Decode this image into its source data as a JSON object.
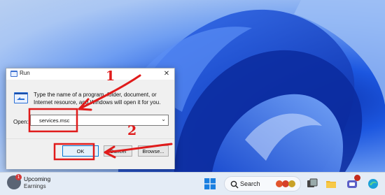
{
  "dialog": {
    "title": "Run",
    "description": "Type the name of a program, folder, document, or Internet resource, and Windows will open it for you.",
    "open_label": "Open:",
    "open_value": "services.msc",
    "ok_label": "OK",
    "cancel_label": "Cancel",
    "browse_label": "Browse...",
    "close_glyph": "✕",
    "dropdown_glyph": "⌄"
  },
  "annotations": {
    "step1": "1",
    "step2": "2",
    "color": "#e01b1b"
  },
  "taskbar": {
    "weather_title": "Upcoming",
    "weather_subtitle": "Earnings",
    "weather_badge": "1",
    "search_label": "Search",
    "icons": [
      "windows-start-icon",
      "search-icon",
      "task-view-icon",
      "file-explorer-icon",
      "teams-icon",
      "browser-icon"
    ]
  },
  "colors": {
    "accent": "#0078d7",
    "wallpaper_deep": "#0a2ea8",
    "wallpaper_light": "#a9c6f3"
  }
}
